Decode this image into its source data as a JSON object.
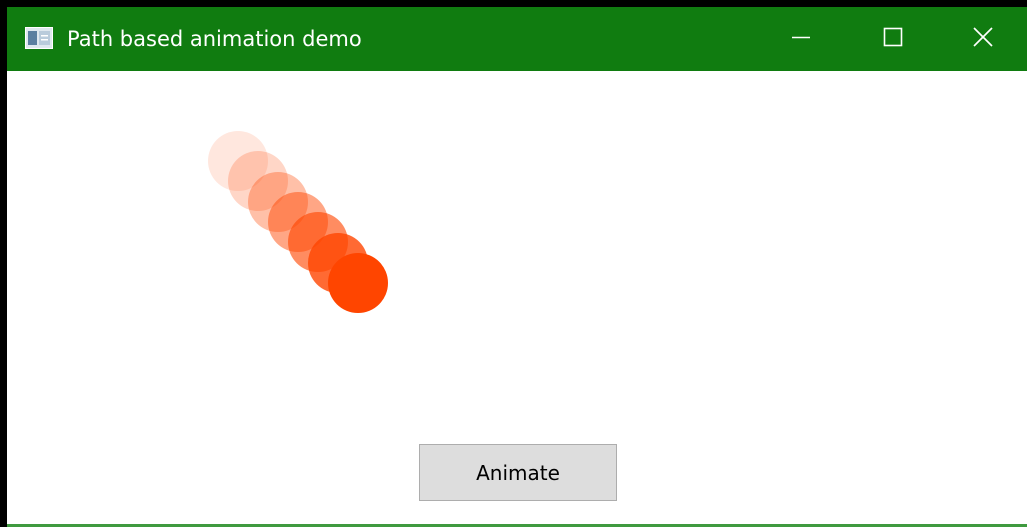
{
  "window": {
    "title": "Path based animation demo",
    "caption_buttons": [
      {
        "name": "minimize-button",
        "icon": "minimize-icon"
      },
      {
        "name": "maximize-button",
        "icon": "maximize-icon"
      },
      {
        "name": "close-button",
        "icon": "close-icon"
      }
    ]
  },
  "animation": {
    "ball_color": "#ff4500",
    "trail": [
      {
        "opacity": 0.13
      },
      {
        "opacity": 0.22
      },
      {
        "opacity": 0.34
      },
      {
        "opacity": 0.48
      },
      {
        "opacity": 0.62
      },
      {
        "opacity": 0.8
      },
      {
        "opacity": 1.0
      }
    ]
  },
  "actions": {
    "animate_label": "Animate"
  },
  "colors": {
    "titlebar": "#107c10",
    "button_face": "#dddddd",
    "accent": "#ff4500"
  }
}
